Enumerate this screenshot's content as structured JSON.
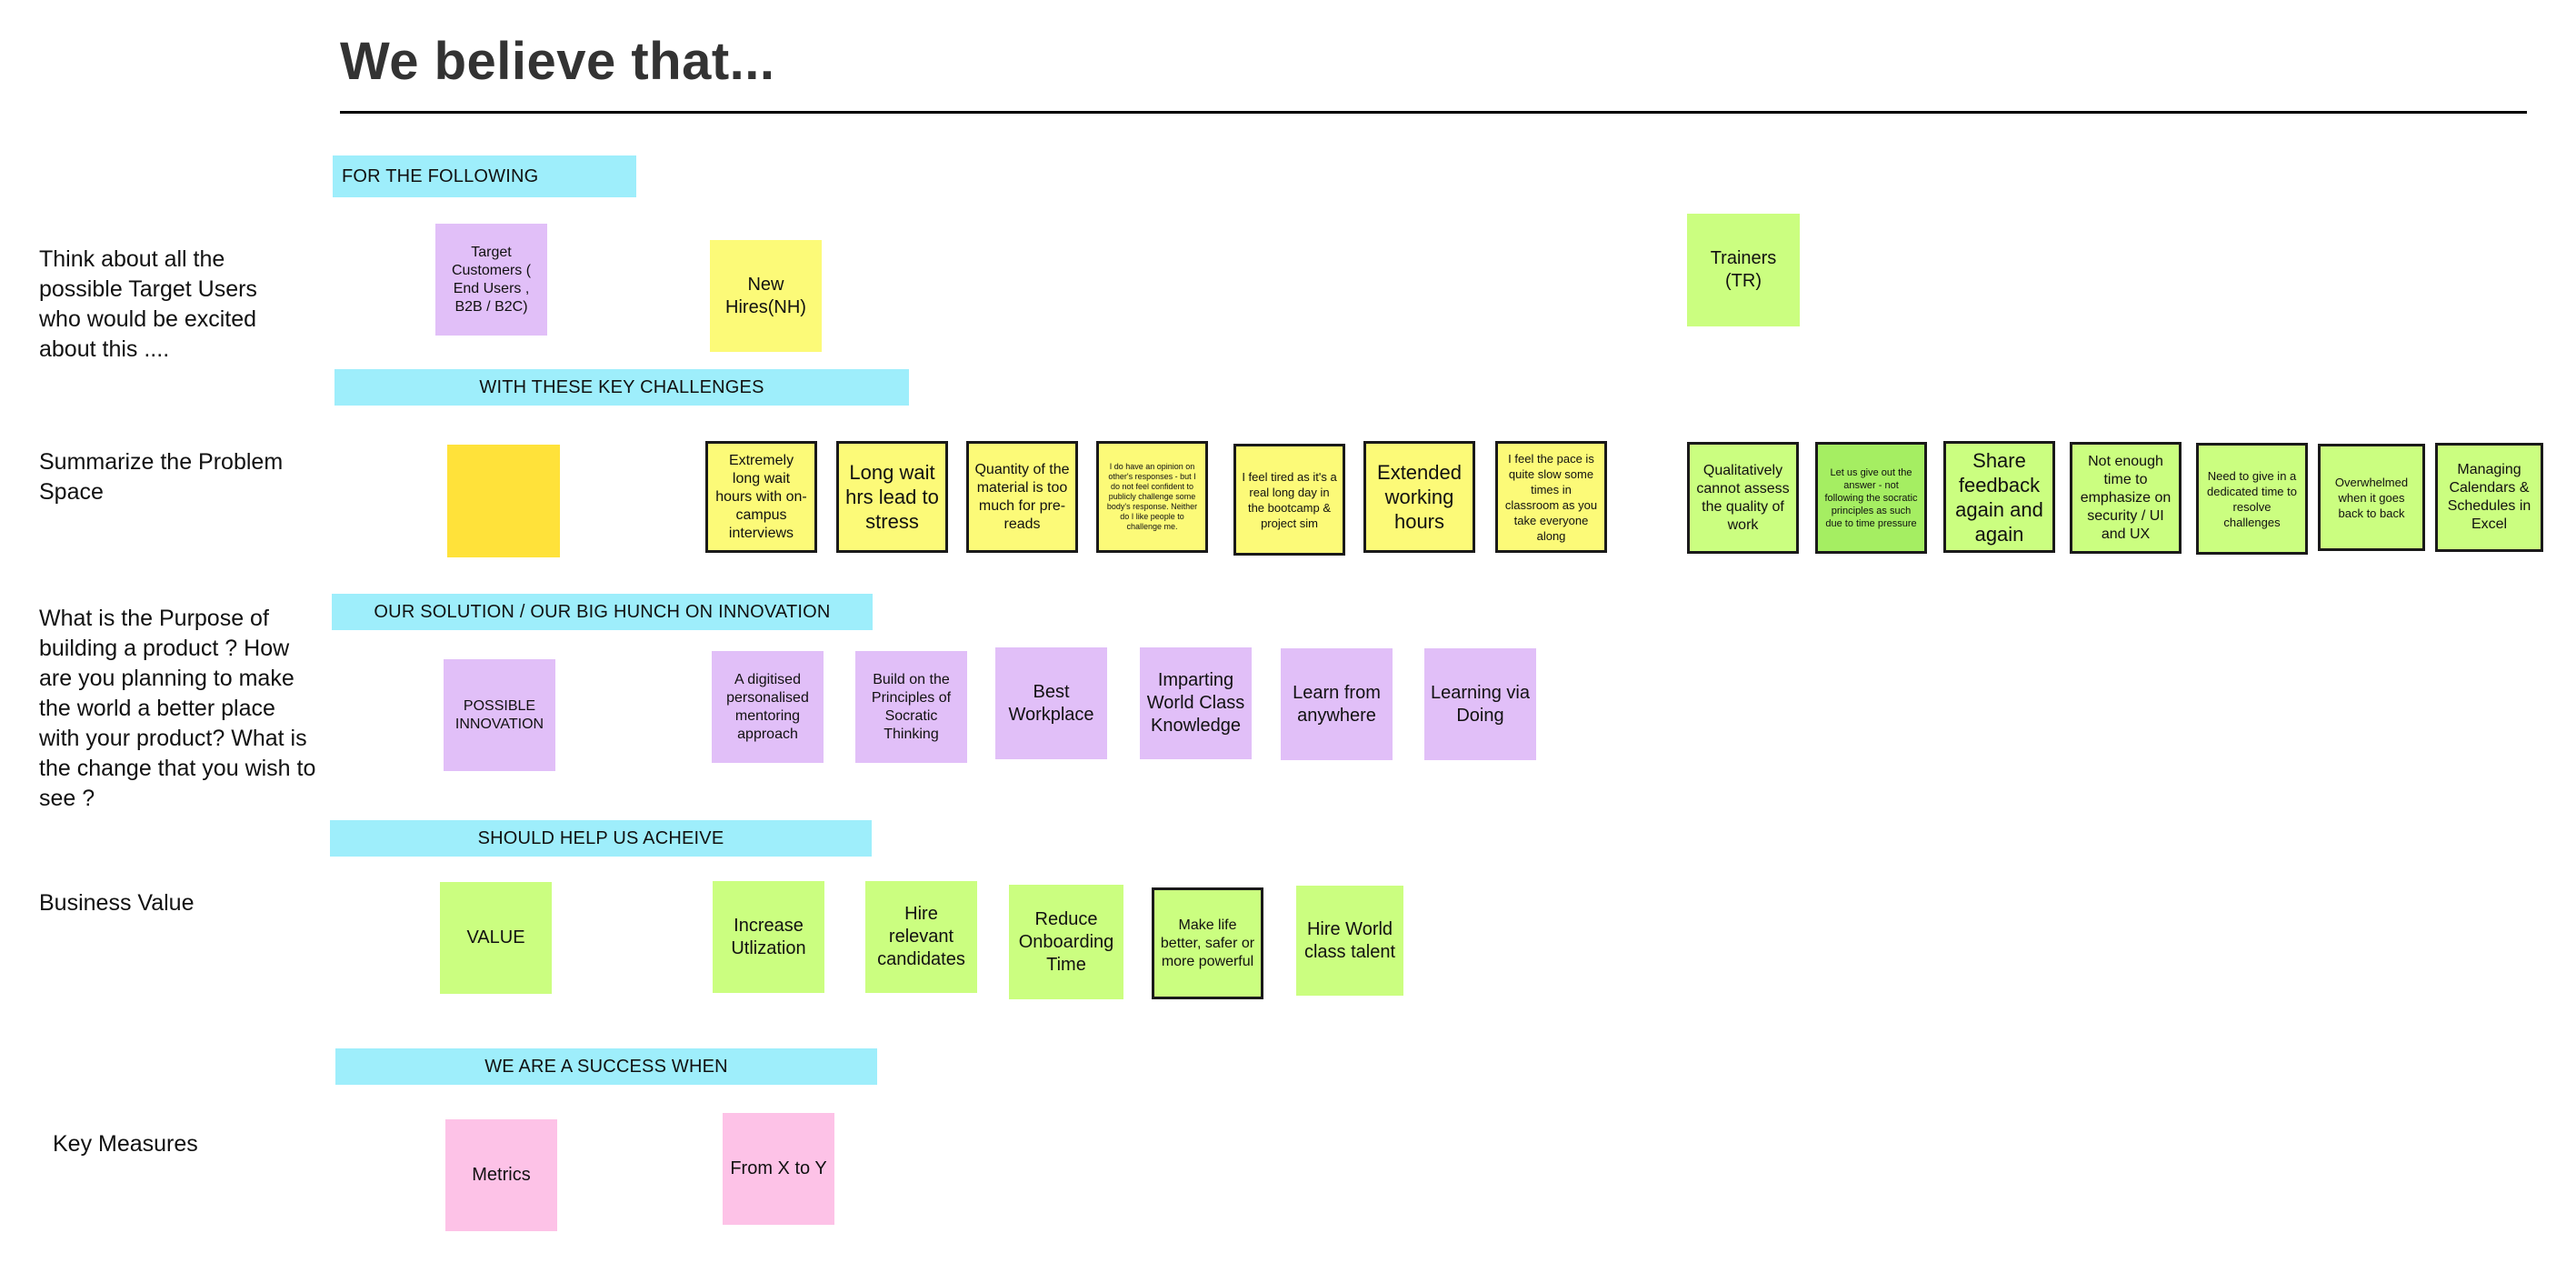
{
  "colors": {
    "banner": "#9eeefb",
    "yellow_sticky": "#fcfa78",
    "dark_yellow_sticky": "#ffe23a",
    "purple_sticky": "#e1bff8",
    "lime_sticky": "#cbfe80",
    "green_sticky": "#a5ee62",
    "pink_sticky": "#fdc2e7",
    "title": "#333333"
  },
  "header": {
    "title": "We believe that..."
  },
  "rows": [
    {
      "label": "Think about all the possible Target Users who would be excited about this ....",
      "banner": "FOR THE FOLLOWING",
      "stickies": [
        {
          "text": "Target Customers ( End Users , B2B / B2C)",
          "color": "purple"
        },
        {
          "text": "New Hires(NH)",
          "color": "yellow"
        },
        {
          "text": "Trainers (TR)",
          "color": "lime"
        }
      ]
    },
    {
      "label": "Summarize the Problem Space",
      "banner": "WITH THESE KEY CHALLENGES",
      "stickies": [
        {
          "text": "",
          "color": "dark_yellow"
        },
        {
          "text": "Extremely long wait hours with on-campus interviews",
          "color": "yellow"
        },
        {
          "text": "Long wait hrs lead to stress",
          "color": "yellow"
        },
        {
          "text": "Quantity of the material is too much for pre-reads",
          "color": "yellow"
        },
        {
          "text": "I do have an opinion on other's responses - but I do not feel confident to publicly challenge some body's response. Neither do I like people to challenge me.",
          "color": "yellow"
        },
        {
          "text": "I feel tired as it's a real long day in the bootcamp & project sim",
          "color": "yellow"
        },
        {
          "text": "Extended working hours",
          "color": "yellow"
        },
        {
          "text": "I feel the pace is quite slow some times in classroom as you take everyone along",
          "color": "yellow"
        },
        {
          "text": "Qualitatively cannot assess the quality of work",
          "color": "lime"
        },
        {
          "text": "Let us give out the answer - not following the socratic principles as such due to time pressure",
          "color": "green"
        },
        {
          "text": "Share feedback again and again",
          "color": "lime"
        },
        {
          "text": "Not enough time to emphasize  on security / UI and UX",
          "color": "lime"
        },
        {
          "text": "Need to give in a dedicated time to resolve challenges",
          "color": "lime"
        },
        {
          "text": "Overwhelmed when it goes back to back",
          "color": "lime"
        },
        {
          "text": "Managing Calendars & Schedules in Excel",
          "color": "lime"
        }
      ]
    },
    {
      "label": "What is the Purpose of building a product ? How are you planning to make the world a better place with your product? What is the change that you wish to see ?",
      "banner": "OUR SOLUTION / OUR BIG HUNCH ON INNOVATION",
      "stickies": [
        {
          "text": "POSSIBLE INNOVATION",
          "color": "purple"
        },
        {
          "text": "A digitised personalised mentoring approach",
          "color": "purple"
        },
        {
          "text": "Build on the Principles of Socratic Thinking",
          "color": "purple"
        },
        {
          "text": "Best Workplace",
          "color": "purple"
        },
        {
          "text": "Imparting World Class Knowledge",
          "color": "purple"
        },
        {
          "text": "Learn from anywhere",
          "color": "purple"
        },
        {
          "text": "Learning via Doing",
          "color": "purple"
        }
      ]
    },
    {
      "label": "Business Value",
      "banner": "SHOULD HELP US ACHEIVE",
      "stickies": [
        {
          "text": "VALUE",
          "color": "lime"
        },
        {
          "text": "Increase Utlization",
          "color": "lime"
        },
        {
          "text": "Hire relevant candidates",
          "color": "lime"
        },
        {
          "text": "Reduce Onboarding Time",
          "color": "lime"
        },
        {
          "text": "Make life better, safer or more powerful",
          "color": "lime"
        },
        {
          "text": "Hire World class talent",
          "color": "lime"
        }
      ]
    },
    {
      "label": "Key Measures",
      "banner": "WE ARE A SUCCESS WHEN",
      "stickies": [
        {
          "text": "Metrics",
          "color": "pink"
        },
        {
          "text": "From X to Y",
          "color": "pink"
        }
      ]
    }
  ]
}
